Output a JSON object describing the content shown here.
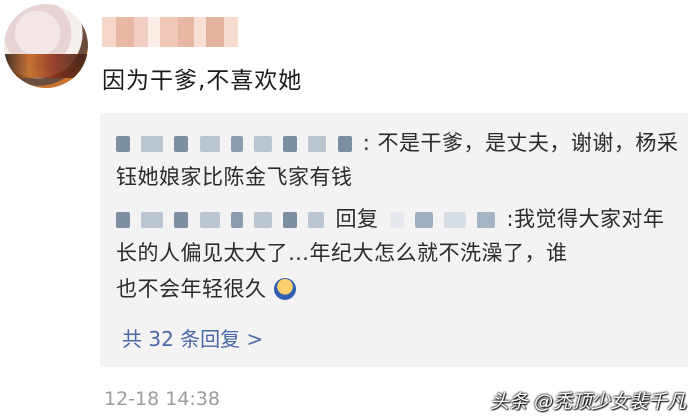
{
  "post": {
    "text": "因为干爹,不喜欢她",
    "timestamp": "12-18 14:38"
  },
  "replies": [
    {
      "line1": ": 不是干爹，是丈夫，谢谢，杨采",
      "line2": "钰她娘家比陈金飞家有钱"
    },
    {
      "part1": "回复",
      "part2": ":我觉得大家对年",
      "line2": "长的人偏见太大了…年纪大怎么就不洗澡了，谁",
      "line3": "也不会年轻很久"
    }
  ],
  "reply_count_label": "共 32 条回复 >",
  "watermark": "头条 @秃顶少女裴千凡",
  "colors": {
    "link": "#4a67a8",
    "reply_bg": "#f3f3f3",
    "time": "#9c9c9c"
  },
  "icons": {
    "emoji": "person-shrug-emoji"
  }
}
